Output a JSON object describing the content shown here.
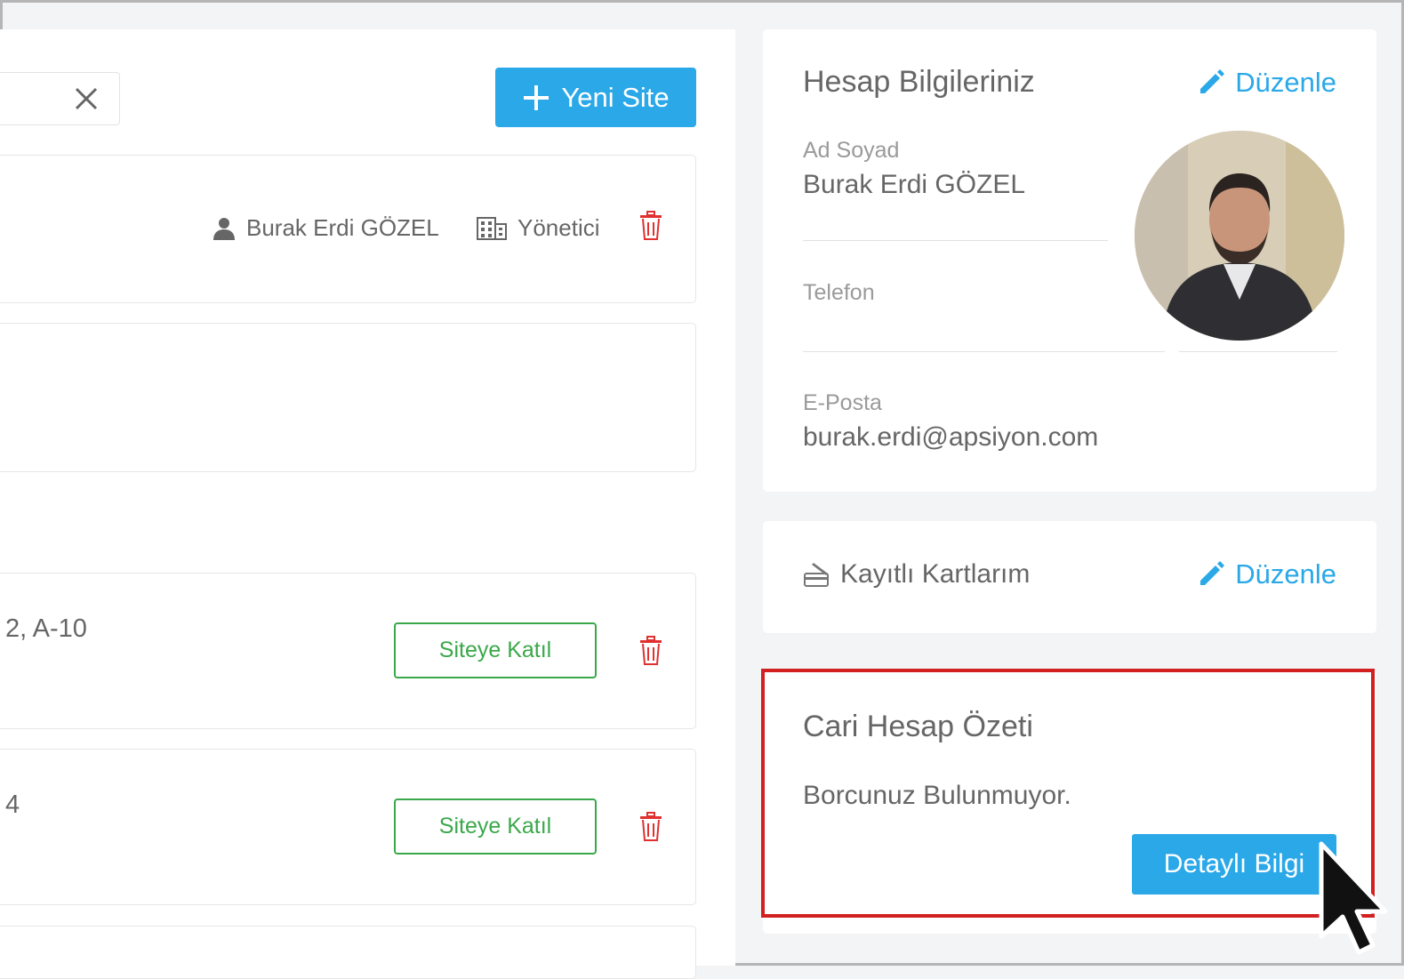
{
  "toolbar": {
    "new_site_label": "Yeni Site"
  },
  "site_list": {
    "managed_site": {
      "user_name": "Burak Erdi GÖZEL",
      "role": "Yönetici"
    },
    "items": [
      {
        "address": "2, A-10",
        "join_label": "Siteye Katıl"
      },
      {
        "address": "4",
        "join_label": "Siteye Katıl"
      }
    ]
  },
  "account": {
    "title": "Hesap Bilgileriniz",
    "edit_label": "Düzenle",
    "name_label": "Ad Soyad",
    "name_value": "Burak Erdi GÖZEL",
    "phone_label": "Telefon",
    "phone_value": "",
    "email_label": "E-Posta",
    "email_value": "burak.erdi@apsiyon.com"
  },
  "cards": {
    "title": "Kayıtlı Kartlarım",
    "edit_label": "Düzenle"
  },
  "balance": {
    "title": "Cari Hesap Özeti",
    "status": "Borcunuz Bulunmuyor.",
    "detail_label": "Detaylı Bilgi"
  },
  "colors": {
    "accent": "#2aa8e8",
    "join_green": "#3aa84a",
    "delete_red": "#e03030",
    "highlight_red": "#d21f1f"
  }
}
